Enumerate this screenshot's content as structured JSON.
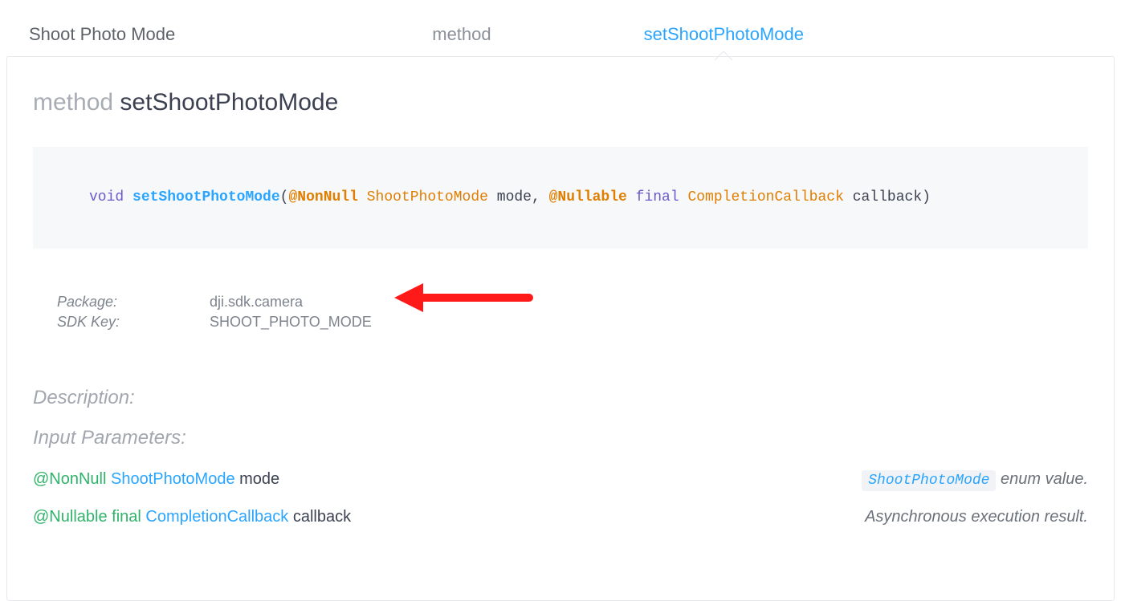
{
  "tabs": {
    "crumb1": "Shoot Photo Mode",
    "crumb2": "method",
    "crumb3": "setShootPhotoMode"
  },
  "title": {
    "prefix": "method",
    "name": "setShootPhotoMode"
  },
  "signature": {
    "kw_void": "void",
    "fn": "setShootPhotoMode",
    "lparen": "(",
    "ann1": "@NonNull",
    "type1": "ShootPhotoMode",
    "name1": "mode",
    "comma": ", ",
    "ann2": "@Nullable",
    "kw_final": "final",
    "type2": "CompletionCallback",
    "name2": "callback",
    "rparen": ")"
  },
  "meta": {
    "package_label": "Package:",
    "package_value": "dji.sdk.camera",
    "sdkkey_label": "SDK Key:",
    "sdkkey_value": "SHOOT_PHOTO_MODE"
  },
  "sections": {
    "description": "Description:",
    "input_params": "Input Parameters:"
  },
  "params": [
    {
      "ann": "@NonNull",
      "kw": "",
      "type": "ShootPhotoMode",
      "name": "mode",
      "desc_chip": "ShootPhotoMode",
      "desc_rest": "  enum value."
    },
    {
      "ann": "@Nullable",
      "kw": "final",
      "type": "CompletionCallback",
      "name": "callback",
      "desc_chip": "",
      "desc_rest": "Asynchronous execution result."
    }
  ]
}
